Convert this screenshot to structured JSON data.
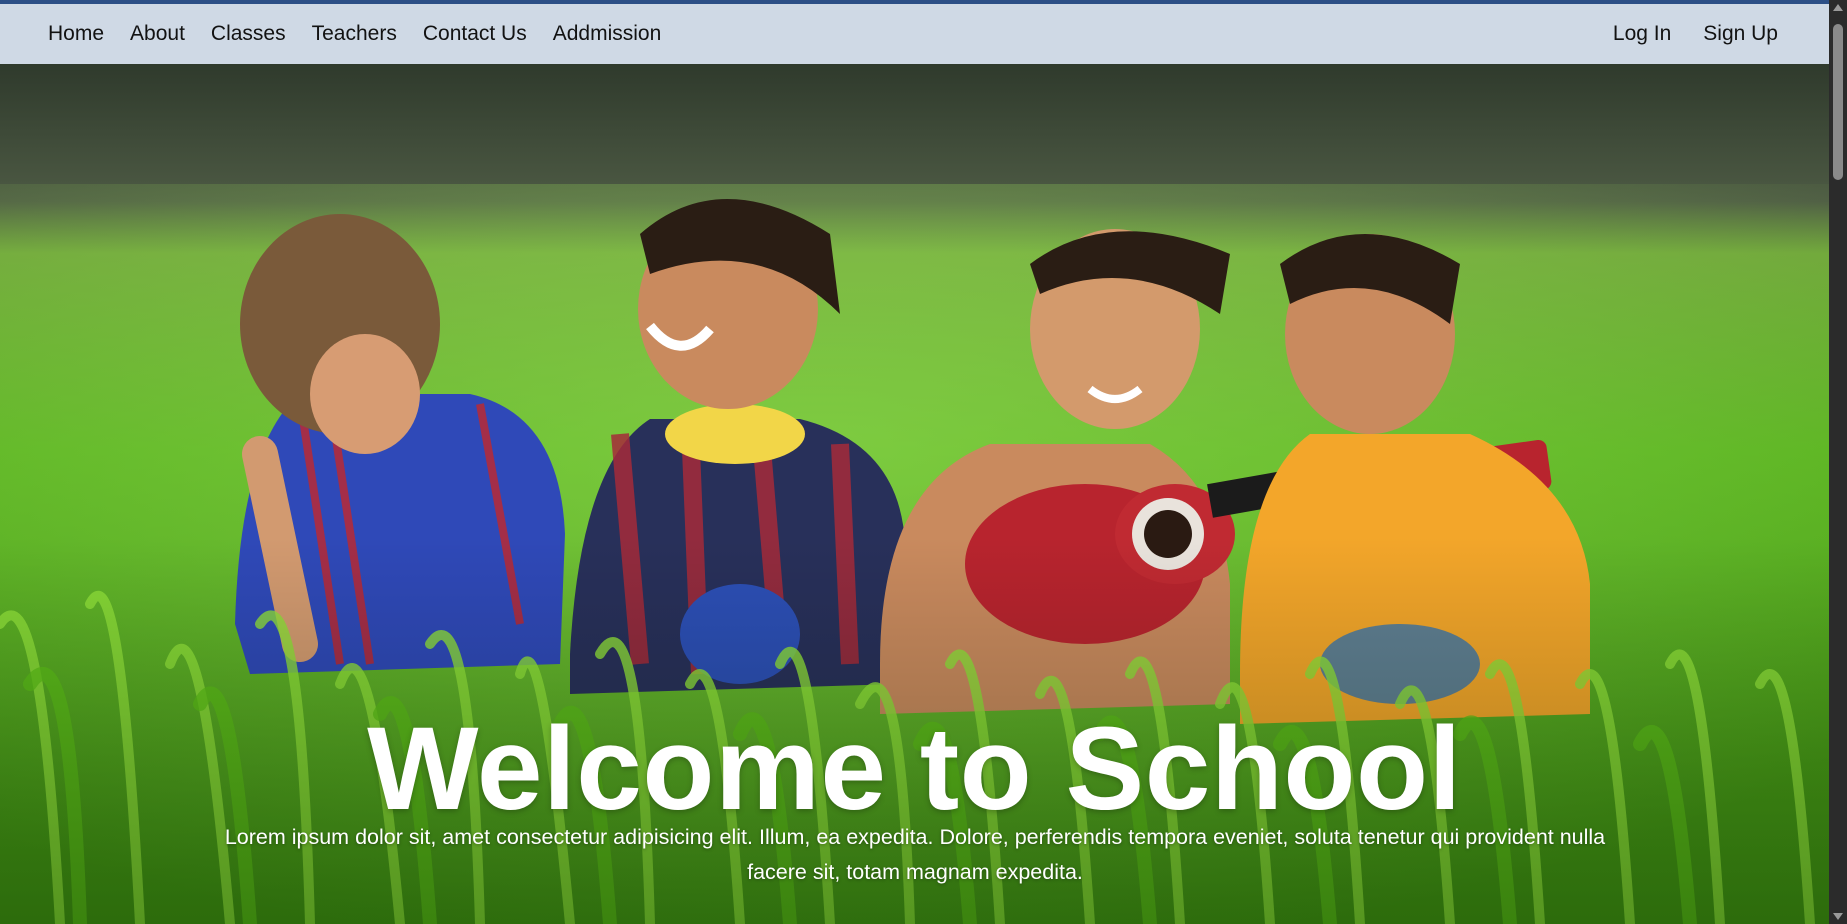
{
  "nav": {
    "left_links": [
      "Home",
      "About",
      "Classes",
      "Teachers",
      "Contact Us",
      "Addmission"
    ],
    "right_links": [
      "Log In",
      "Sign Up"
    ]
  },
  "hero": {
    "title": "Welcome to School",
    "subtitle": "Lorem ipsum dolor sit, amet consectetur adipisicing elit. Illum, ea expedita. Dolore, perferendis tempora eveniet, soluta tenetur qui provident nulla facere sit, totam magnam expedita."
  },
  "colors": {
    "navbar_bg": "#cfd9e5",
    "top_stripe": "#2c4f86",
    "hero_text": "#ffffff",
    "grass": "#5fbf1e"
  }
}
